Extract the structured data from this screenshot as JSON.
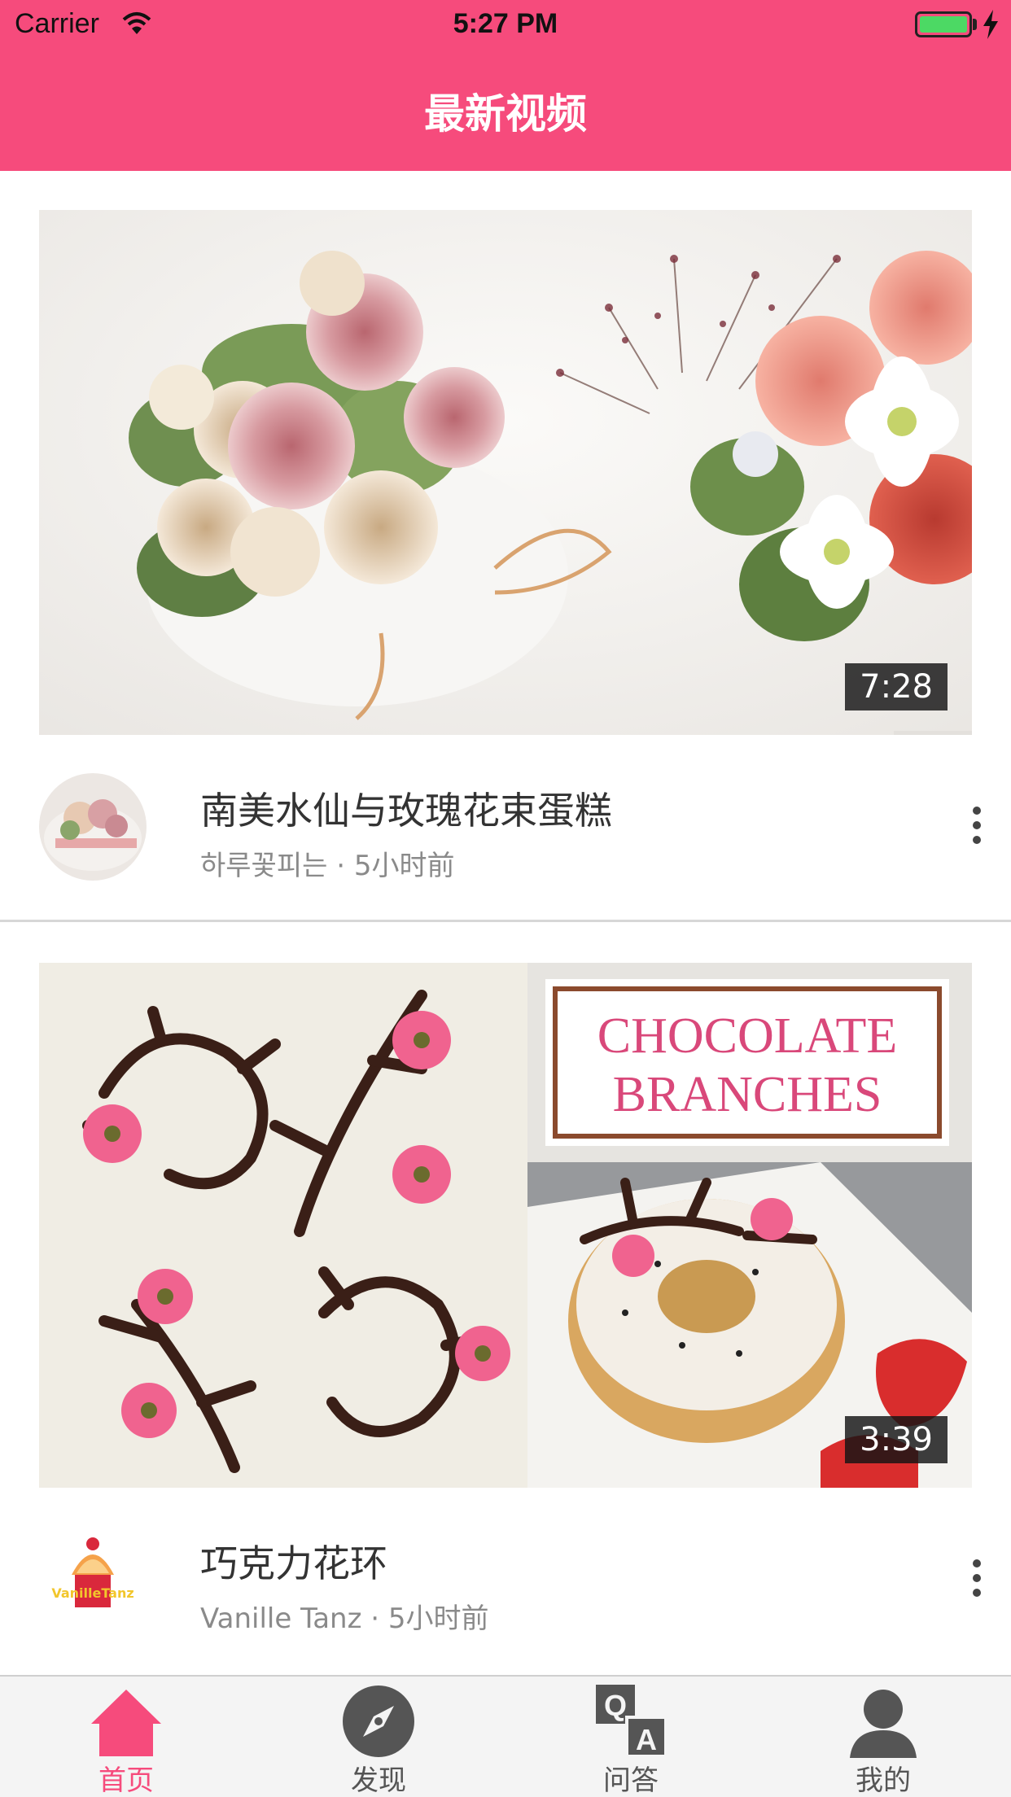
{
  "status_bar": {
    "carrier": "Carrier",
    "time": "5:27 PM"
  },
  "nav": {
    "title": "最新视频"
  },
  "colors": {
    "brand": "#f64b7c",
    "tab_active": "#f64b7c",
    "tab_inactive": "#555555"
  },
  "videos": [
    {
      "duration": "7:28",
      "title": "南美水仙与玫瑰花束蛋糕",
      "subtitle": "하루꽃피는 · 5小时前"
    },
    {
      "duration": "3:39",
      "title": "巧克力花环",
      "subtitle": "Vanille Tanz · 5小时前",
      "thumb_text": {
        "line1": "CHOCOLATE",
        "line2": "BRANCHES"
      },
      "avatar_text": "VanilleTanz"
    }
  ],
  "tabs": [
    {
      "label": "首页",
      "icon": "home-icon",
      "active": true
    },
    {
      "label": "发现",
      "icon": "compass-icon",
      "active": false
    },
    {
      "label": "问答",
      "icon": "qa-icon",
      "active": false,
      "glyphs": {
        "q": "Q",
        "a": "A"
      }
    },
    {
      "label": "我的",
      "icon": "profile-icon",
      "active": false
    }
  ]
}
